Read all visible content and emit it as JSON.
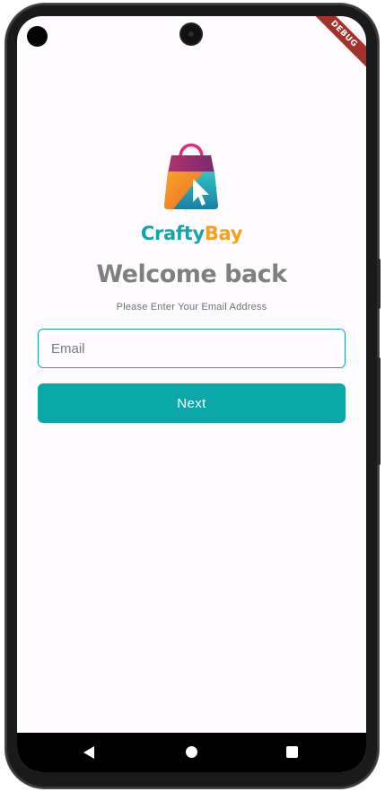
{
  "debug_banner": "DEBUG",
  "brand": {
    "part1": "Crafty",
    "part2": "Bay",
    "color1": "#12a7a5",
    "color2": "#f6a01c"
  },
  "login": {
    "title": "Welcome back",
    "subtitle": "Please Enter Your Email Address",
    "email_placeholder": "Email",
    "email_value": "",
    "next_label": "Next"
  },
  "colors": {
    "accent": "#0ca8a9",
    "title_gray": "#808080"
  },
  "navbar": {
    "icons": [
      "back-icon",
      "home-icon",
      "recent-apps-icon"
    ]
  }
}
